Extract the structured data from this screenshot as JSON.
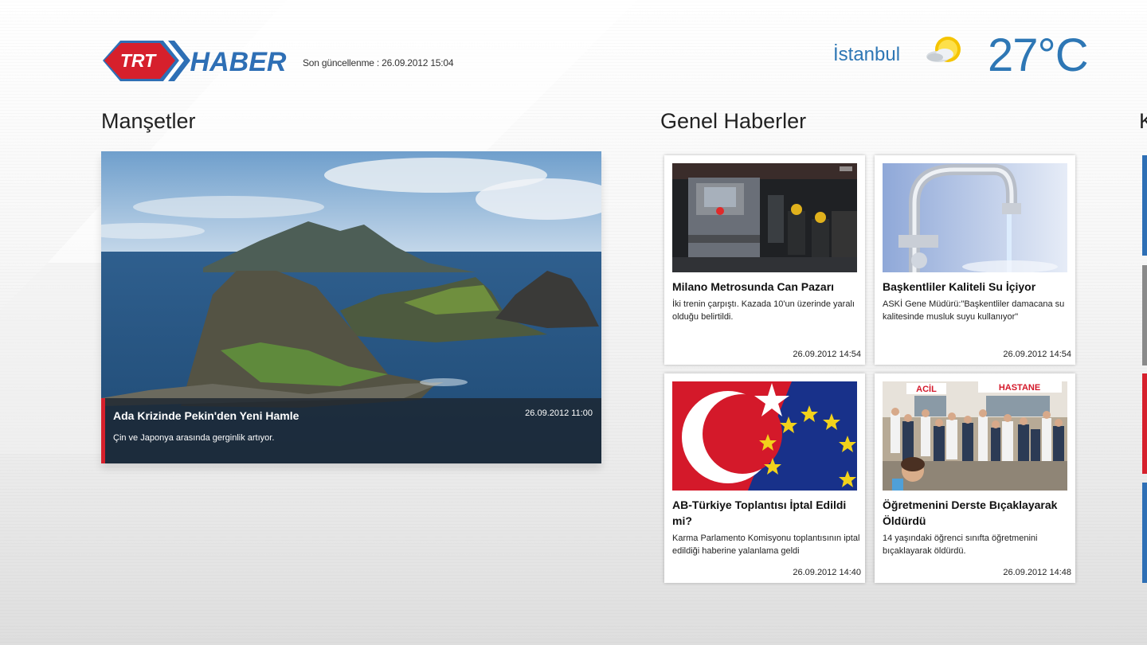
{
  "header": {
    "logo_text_left": "TRT",
    "logo_text_right": "HABER",
    "last_update": "Son güncellenme : 26.09.2012 15:04",
    "weather": {
      "city": "İstanbul",
      "temperature": "27°C",
      "icon": "partly-cloudy-icon"
    }
  },
  "sections": {
    "headlines_title": "Manşetler",
    "general_title": "Genel Haberler",
    "third_title": "K"
  },
  "hero": {
    "title": "Ada Krizinde Pekin'den Yeni Hamle",
    "date": "26.09.2012 11:00",
    "summary": "Çin ve Japonya arasında gerginlik artıyor."
  },
  "cards": [
    {
      "title": "Milano Metrosunda Can Pazarı",
      "summary": "İki trenin çarpıştı. Kazada 10'un üzerinde yaralı olduğu belirtildi.",
      "date": "26.09.2012 14:54"
    },
    {
      "title": "Başkentliler Kaliteli Su İçiyor",
      "summary": "ASKİ Gene Müdürü:\"Başkentliler damacana su kalitesinde musluk suyu kullanıyor\"",
      "date": "26.09.2012 14:54"
    },
    {
      "title": "AB-Türkiye Toplantısı İptal Edildi mi?",
      "summary": "Karma Parlamento Komisyonu toplantısının iptal edildiği haberine yalanlama geldi",
      "date": "26.09.2012 14:40"
    },
    {
      "title": "Öğretmenini Derste Bıçaklayarak Öldürdü",
      "summary": "14 yaşındaki öğrenci sınıfta öğretmenini bıçaklayarak öldürdü.",
      "date": "26.09.2012 14:48"
    }
  ],
  "image_text": {
    "acil": "ACİL",
    "hastane": "HASTANE"
  },
  "colors": {
    "accent_blue": "#2e77b5",
    "brand_red": "#d6202c",
    "side_tiles": [
      "#2e6fb5",
      "#8a8a8a",
      "#d6202c",
      "#2e6fb5"
    ]
  }
}
